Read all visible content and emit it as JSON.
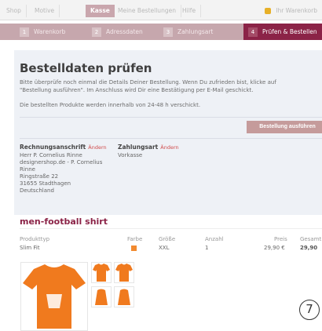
{
  "topnav": {
    "tabs": [
      "Shop",
      "Motive",
      "Kasse",
      "Meine Bestellungen",
      "Hilfe"
    ],
    "cart_label": "Ihr Warenkorb"
  },
  "steps": [
    {
      "num": "1",
      "label": "Warenkorb"
    },
    {
      "num": "2",
      "label": "Adressdaten"
    },
    {
      "num": "3",
      "label": "Zahlungsart"
    },
    {
      "num": "4",
      "label": "Prüfen & Bestellen"
    }
  ],
  "main": {
    "title": "Bestelldaten prüfen",
    "intro_line1": "Bitte überprüfe noch einmal die Details Deiner Bestellung. Wenn Du zufrieden bist, klicke auf",
    "intro_line2": "\"Bestellung ausführen\". Im Anschluss wird Dir eine Bestätigung per E-Mail geschickt.",
    "shipping_note": "Die bestellten Produkte werden innerhalb von 24-48 h verschickt.",
    "submit_label": "Bestellung ausführen"
  },
  "billing": {
    "heading": "Rechnungsanschrift",
    "edit_label": "Ändern",
    "lines": [
      "Herr P. Cornelius Rinne",
      "designershop.de - P. Cornelius",
      "Rinne",
      "Ringstraße 22",
      "31655 Stadthagen",
      "Deutschland"
    ]
  },
  "payment": {
    "heading": "Zahlungsart",
    "edit_label": "Ändern",
    "value": "Vorkasse"
  },
  "product": {
    "title": "men-football shirt",
    "columns": [
      "Produkttyp",
      "Farbe",
      "Größe",
      "Anzahl",
      "Preis",
      "Gesamt"
    ],
    "row": {
      "type": "Slim Fit",
      "size": "XXL",
      "qty": "1",
      "price": "29,90 €",
      "total": "29,90"
    },
    "color_swatch": "#f28a2f"
  },
  "badge": "7"
}
